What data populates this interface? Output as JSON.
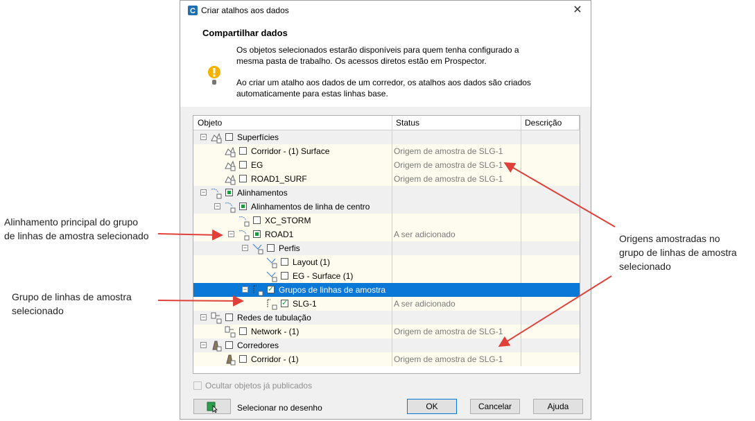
{
  "window": {
    "title": "Criar atalhos aos dados",
    "close_glyph": "✕"
  },
  "header": {
    "heading": "Compartilhar dados",
    "message_1_line_1": "Os objetos selecionados estarão disponíveis para quem tenha configurado a",
    "message_1_line_2": "mesma pasta de trabalho. Os acessos diretos estão em Prospector.",
    "message_2_line_1": "Ao criar um atalho aos dados de um corredor, os atalhos aos dados são criados",
    "message_2_line_2": "automaticamente para estas linhas base."
  },
  "grid": {
    "columns": [
      "Objeto",
      "Status",
      "Descrição"
    ],
    "rows": [
      {
        "label": "Superfícies",
        "status": ""
      },
      {
        "label": "Corridor - (1) Surface",
        "status": "Origem de amostra de SLG-1"
      },
      {
        "label": "EG",
        "status": "Origem de amostra de SLG-1"
      },
      {
        "label": "ROAD1_SURF",
        "status": "Origem de amostra de SLG-1"
      },
      {
        "label": "Alinhamentos",
        "status": ""
      },
      {
        "label": "Alinhamentos de linha de centro",
        "status": ""
      },
      {
        "label": "XC_STORM",
        "status": ""
      },
      {
        "label": "ROAD1",
        "status": "A ser adicionado"
      },
      {
        "label": "Perfis",
        "status": ""
      },
      {
        "label": "Layout (1)",
        "status": ""
      },
      {
        "label": "EG - Surface (1)",
        "status": ""
      },
      {
        "label": "Grupos de linhas de amostra",
        "status": ""
      },
      {
        "label": "SLG-1",
        "status": "A ser adicionado"
      },
      {
        "label": "Redes de tubulação",
        "status": ""
      },
      {
        "label": "Network - (1)",
        "status": "Origem de amostra de SLG-1"
      },
      {
        "label": "Corredores",
        "status": ""
      },
      {
        "label": "Corridor - (1)",
        "status": "Origem de amostra de SLG-1"
      }
    ]
  },
  "footer": {
    "hide_published_label": "Ocultar objetos já publicados",
    "select_in_drawing_label": "Selecionar no desenho",
    "ok_label": "OK",
    "cancel_label": "Cancelar",
    "help_label": "Ajuda"
  },
  "annotations": {
    "left_1_line_1": "Alinhamento principal do grupo",
    "left_1_line_2": "de linhas de amostra selecionado",
    "left_2_line_1": "Grupo de linhas de amostra",
    "left_2_line_2": "selecionado",
    "right_line_1": "Origens amostradas no",
    "right_line_2": "grupo de linhas de amostra",
    "right_line_3": "selecionado"
  },
  "colors": {
    "accent": "#0a78d7",
    "arrow": "#e0403a",
    "check_green": "#1d9a3e",
    "item_row_bg": "#fdfcee"
  }
}
